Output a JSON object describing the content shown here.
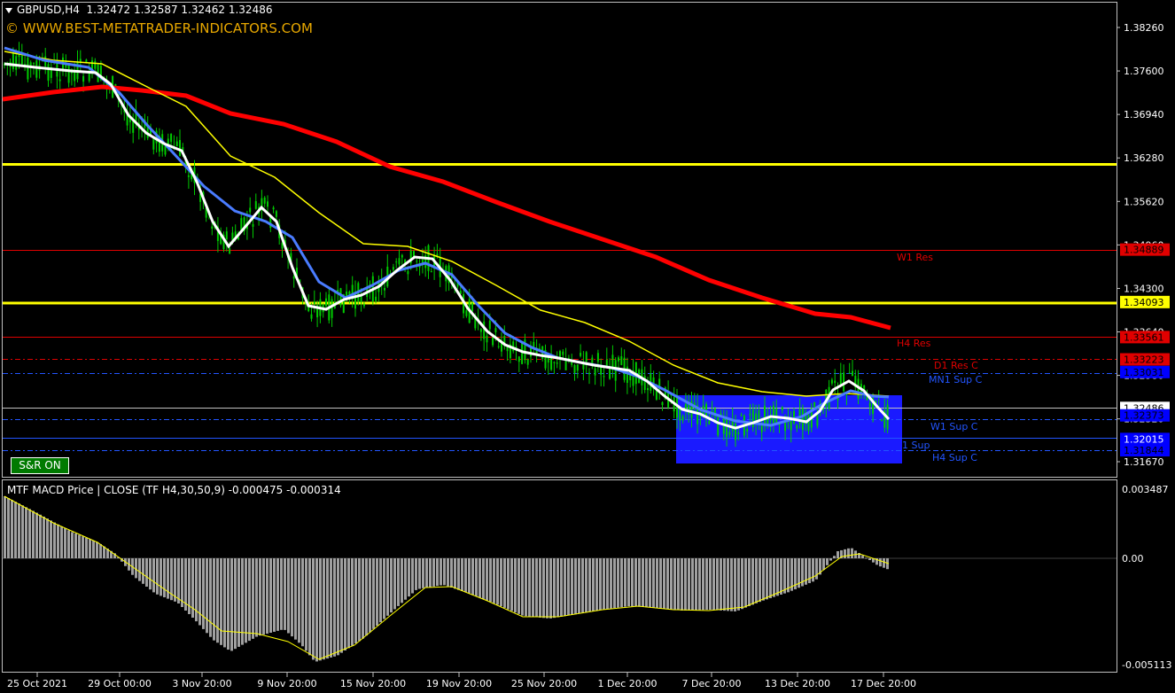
{
  "header": {
    "symbol": "GBPUSD,H4",
    "ohlc": "1.32472 1.32587 1.32462 1.32486",
    "copyright": "© WWW.BEST-METATRADER-INDICATORS.COM"
  },
  "sr_button": "S&R ON",
  "price_axis": [
    "1.38260",
    "1.37600",
    "1.36940",
    "1.36280",
    "1.35620",
    "1.34960",
    "1.34300",
    "1.33640",
    "1.32980",
    "1.32320",
    "1.31670"
  ],
  "price_tags": [
    {
      "price": "1.34889",
      "color": "#e00000",
      "text": "#000000"
    },
    {
      "price": "1.34093",
      "color": "#ffff00",
      "text": "#000000"
    },
    {
      "price": "1.33561",
      "color": "#e00000",
      "text": "#000000"
    },
    {
      "price": "1.33223",
      "color": "#e00000",
      "text": "#000000"
    },
    {
      "price": "1.33031",
      "color": "#0000ff",
      "text": "#000000"
    },
    {
      "price": "1.32486",
      "color": "#ffffff",
      "text": "#000000"
    },
    {
      "price": "1.32373",
      "color": "#0000ff",
      "text": "#000000"
    },
    {
      "price": "1.32015",
      "color": "#0000ff",
      "text": "#ffffff"
    },
    {
      "price": "1.31844",
      "color": "#0000ff",
      "text": "#000000"
    }
  ],
  "level_labels": [
    {
      "text": "W1 Res",
      "color": "#e00000"
    },
    {
      "text": "H4 Res",
      "color": "#e00000"
    },
    {
      "text": "D1 Res C",
      "color": "#e00000"
    },
    {
      "text": "MN1 Sup C",
      "color": "#2255ff"
    },
    {
      "text": "W1 Sup C",
      "color": "#2255ff"
    },
    {
      "text": "1 Sup",
      "color": "#2255ff"
    },
    {
      "text": "H4 Sup C",
      "color": "#2255ff"
    }
  ],
  "macd": {
    "label": "MTF MACD Price | CLOSE  (TF H4,30,50,9) -0.000475 -0.000314",
    "axis": [
      "0.003487",
      "0.00",
      "-0.005113"
    ]
  },
  "time_axis": [
    "25 Oct 2021",
    "29 Oct 00:00",
    "3 Nov 20:00",
    "9 Nov 20:00",
    "15 Nov 20:00",
    "19 Nov 20:00",
    "25 Nov 20:00",
    "1 Dec 20:00",
    "7 Dec 20:00",
    "13 Dec 20:00",
    "17 Dec 20:00"
  ],
  "colors": {
    "background": "#000000",
    "candle": "#00cc00",
    "ma_long": "#ff0000",
    "ma_mid": "#ffff00",
    "ma_blue": "#4a7cff",
    "ma_fast": "#ffffff",
    "sr_zone": "#1a1aff",
    "histogram": "#a0a0a0",
    "signal": "#ffff00"
  }
}
